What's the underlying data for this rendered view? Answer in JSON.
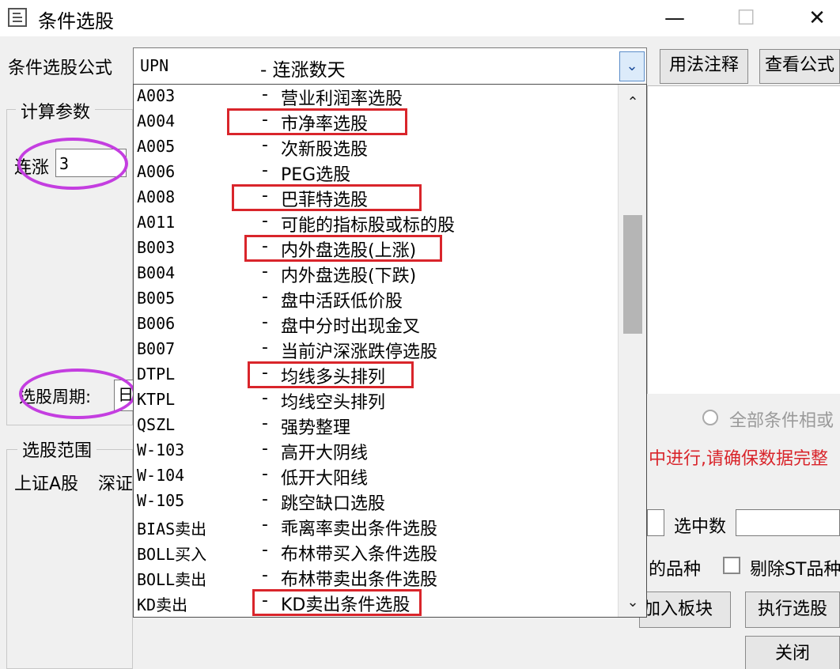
{
  "window": {
    "title": "条件选股",
    "minimize_glyph": "—",
    "maximize_glyph": "☐",
    "close_glyph": "✕"
  },
  "formula": {
    "label": "条件选股公式",
    "selected_code": "UPN",
    "selected_name": "- 连涨数天",
    "dropdown_arrow": "⌄"
  },
  "buttons": {
    "usage_notes": "用法注释",
    "view_formula": "查看公式",
    "add_to_block": "加入板块",
    "execute": "执行选股",
    "close": "关闭"
  },
  "params": {
    "group_title": "计算参数",
    "param_label": "连涨",
    "param_value": "3",
    "period_label": "选股周期:",
    "period_value": "日"
  },
  "scope": {
    "group_title": "选股范围",
    "markets": [
      "上证A股",
      "深证"
    ]
  },
  "options": {
    "all_conditions": "全部条件相或",
    "warning": "中进行,请确保数据完整",
    "selected_count_label": "选中数",
    "varieties_label": "的品种",
    "exclude_st_label": "剔除ST品种"
  },
  "dropdown": {
    "items": [
      {
        "code": "A003",
        "name": "营业利润率选股"
      },
      {
        "code": "A004",
        "name": "市净率选股"
      },
      {
        "code": "A005",
        "name": "次新股选股"
      },
      {
        "code": "A006",
        "name": "PEG选股"
      },
      {
        "code": "A008",
        "name": "巴菲特选股"
      },
      {
        "code": "A011",
        "name": "可能的指标股或标的股"
      },
      {
        "code": "B003",
        "name": "内外盘选股(上涨)"
      },
      {
        "code": "B004",
        "name": "内外盘选股(下跌)"
      },
      {
        "code": "B005",
        "name": "盘中活跃低价股"
      },
      {
        "code": "B006",
        "name": "盘中分时出现金叉"
      },
      {
        "code": "B007",
        "name": "当前沪深涨跌停选股"
      },
      {
        "code": "DTPL",
        "name": "均线多头排列"
      },
      {
        "code": "KTPL",
        "name": "均线空头排列"
      },
      {
        "code": "QSZL",
        "name": "强势整理"
      },
      {
        "code": "W-103",
        "name": "高开大阴线"
      },
      {
        "code": "W-104",
        "name": "低开大阳线"
      },
      {
        "code": "W-105",
        "name": "跳空缺口选股"
      },
      {
        "code": "BIAS卖出",
        "name": "乖离率卖出条件选股"
      },
      {
        "code": "BOLL买入",
        "name": "布林带买入条件选股"
      },
      {
        "code": "BOLL卖出",
        "name": "布林带卖出条件选股"
      },
      {
        "code": "KD卖出",
        "name": "KD卖出条件选股"
      }
    ],
    "dash": "-",
    "scroll_up": "⌃",
    "scroll_down": "⌄"
  },
  "colors": {
    "highlight_box": "#d9252b",
    "annotation_circle": "#c43ee0",
    "warning_text": "#d9252b"
  }
}
